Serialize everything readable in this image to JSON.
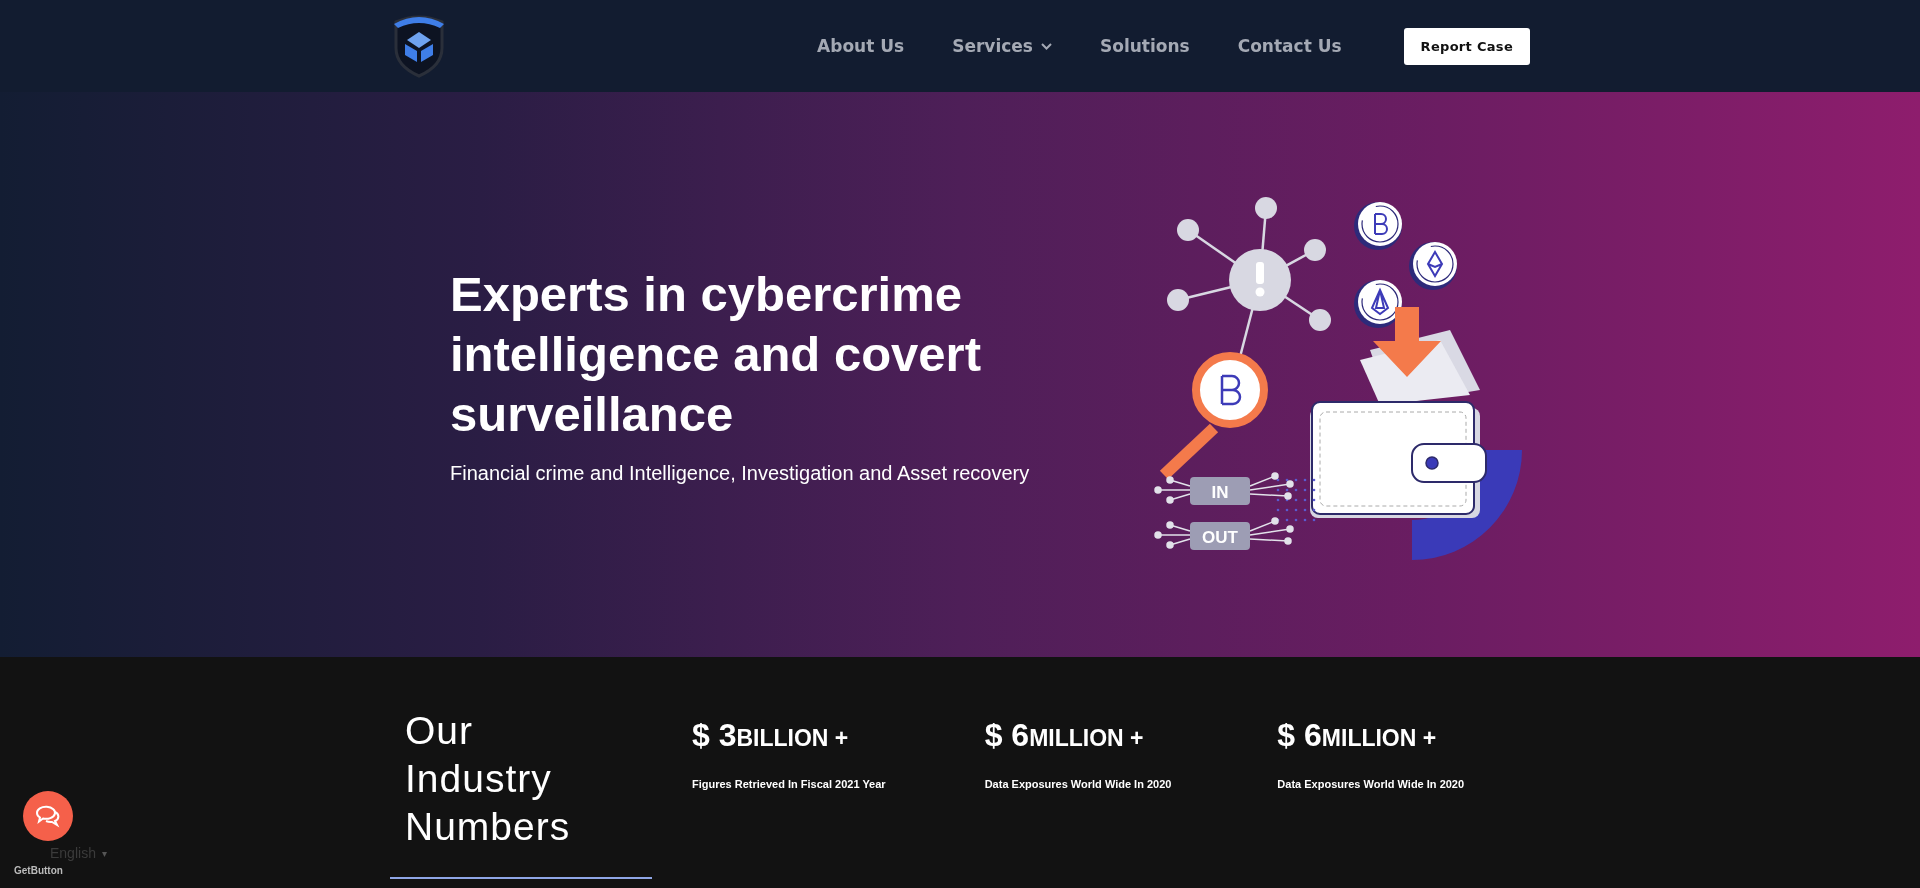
{
  "nav": {
    "items": [
      {
        "label": "About Us",
        "has_dropdown": false
      },
      {
        "label": "Services",
        "has_dropdown": true
      },
      {
        "label": "Solutions",
        "has_dropdown": false
      },
      {
        "label": "Contact Us",
        "has_dropdown": false
      }
    ],
    "cta": "Report Case"
  },
  "hero": {
    "title": "Experts in cybercrime intelligence and covert surveillance",
    "subtitle": "Financial crime and Intelligence, Investigation and Asset recovery",
    "illustration": {
      "in_label": "IN",
      "out_label": "OUT"
    }
  },
  "stats": {
    "heading": "Our Industry Numbers",
    "items": [
      {
        "prefix": "$ ",
        "number": "3",
        "unit": "BILLION +",
        "caption": "Figures Retrieved In Fiscal 2021 Year"
      },
      {
        "prefix": "$ ",
        "number": "6",
        "unit": "MILLION +",
        "caption": "Data Exposures World Wide In 2020"
      },
      {
        "prefix": "$ ",
        "number": "6",
        "unit": "MILLION +",
        "caption": "Data Exposures World Wide In 2020"
      }
    ]
  },
  "widget": {
    "language": "English",
    "caret": "▾",
    "brand": "GetButton"
  }
}
